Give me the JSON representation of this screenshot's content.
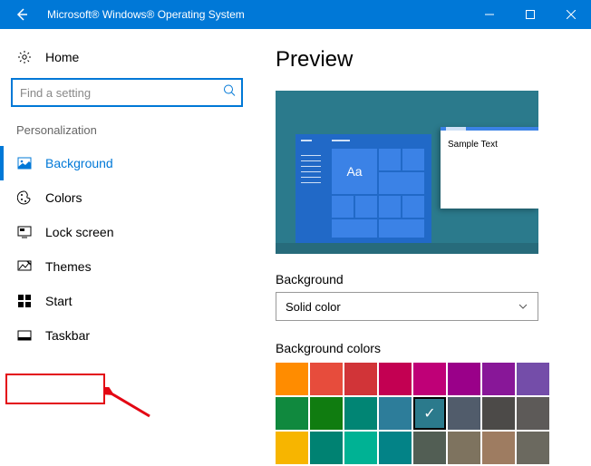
{
  "titlebar": {
    "title": "Microsoft® Windows® Operating System"
  },
  "sidebar": {
    "home_label": "Home",
    "search_placeholder": "Find a setting",
    "section_label": "Personalization",
    "items": [
      {
        "label": "Background"
      },
      {
        "label": "Colors"
      },
      {
        "label": "Lock screen"
      },
      {
        "label": "Themes"
      },
      {
        "label": "Start"
      },
      {
        "label": "Taskbar"
      }
    ]
  },
  "main": {
    "preview_heading": "Preview",
    "preview_sample_text": "Sample Text",
    "preview_tile_text": "Aa",
    "bg_label": "Background",
    "bg_dropdown_value": "Solid color",
    "colors_label": "Background colors",
    "colors": [
      [
        "#ff8c00",
        "#e74c3c",
        "#d13438",
        "#c30052",
        "#bf0077",
        "#9a0089",
        "#881798",
        "#744da9"
      ],
      [
        "#10893e",
        "#107c10",
        "#018574",
        "#2d7d9a",
        "#2b7a8c",
        "#515c6b",
        "#4c4a48",
        "#5d5a58"
      ],
      [
        "#f7b500",
        "#008272",
        "#00b294",
        "#038387",
        "#525e54",
        "#7e735f",
        "#9e7c61",
        "#6b695f"
      ]
    ],
    "selected_color": "#2b7a8c"
  }
}
